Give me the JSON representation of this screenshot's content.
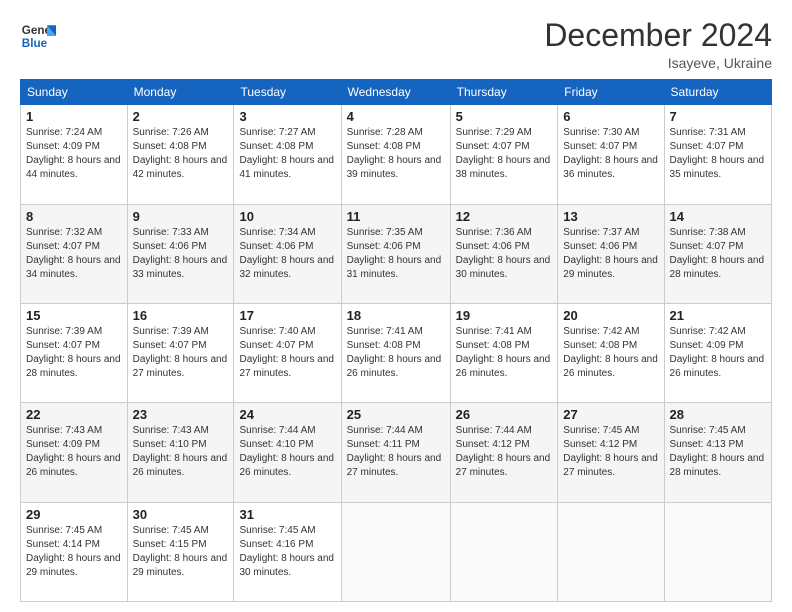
{
  "header": {
    "logo_line1": "General",
    "logo_line2": "Blue",
    "title": "December 2024",
    "subtitle": "Isayeve, Ukraine"
  },
  "days_of_week": [
    "Sunday",
    "Monday",
    "Tuesday",
    "Wednesday",
    "Thursday",
    "Friday",
    "Saturday"
  ],
  "weeks": [
    [
      {
        "num": "1",
        "sunrise": "7:24 AM",
        "sunset": "4:09 PM",
        "daylight": "8 hours and 44 minutes."
      },
      {
        "num": "2",
        "sunrise": "7:26 AM",
        "sunset": "4:08 PM",
        "daylight": "8 hours and 42 minutes."
      },
      {
        "num": "3",
        "sunrise": "7:27 AM",
        "sunset": "4:08 PM",
        "daylight": "8 hours and 41 minutes."
      },
      {
        "num": "4",
        "sunrise": "7:28 AM",
        "sunset": "4:08 PM",
        "daylight": "8 hours and 39 minutes."
      },
      {
        "num": "5",
        "sunrise": "7:29 AM",
        "sunset": "4:07 PM",
        "daylight": "8 hours and 38 minutes."
      },
      {
        "num": "6",
        "sunrise": "7:30 AM",
        "sunset": "4:07 PM",
        "daylight": "8 hours and 36 minutes."
      },
      {
        "num": "7",
        "sunrise": "7:31 AM",
        "sunset": "4:07 PM",
        "daylight": "8 hours and 35 minutes."
      }
    ],
    [
      {
        "num": "8",
        "sunrise": "7:32 AM",
        "sunset": "4:07 PM",
        "daylight": "8 hours and 34 minutes."
      },
      {
        "num": "9",
        "sunrise": "7:33 AM",
        "sunset": "4:06 PM",
        "daylight": "8 hours and 33 minutes."
      },
      {
        "num": "10",
        "sunrise": "7:34 AM",
        "sunset": "4:06 PM",
        "daylight": "8 hours and 32 minutes."
      },
      {
        "num": "11",
        "sunrise": "7:35 AM",
        "sunset": "4:06 PM",
        "daylight": "8 hours and 31 minutes."
      },
      {
        "num": "12",
        "sunrise": "7:36 AM",
        "sunset": "4:06 PM",
        "daylight": "8 hours and 30 minutes."
      },
      {
        "num": "13",
        "sunrise": "7:37 AM",
        "sunset": "4:06 PM",
        "daylight": "8 hours and 29 minutes."
      },
      {
        "num": "14",
        "sunrise": "7:38 AM",
        "sunset": "4:07 PM",
        "daylight": "8 hours and 28 minutes."
      }
    ],
    [
      {
        "num": "15",
        "sunrise": "7:39 AM",
        "sunset": "4:07 PM",
        "daylight": "8 hours and 28 minutes."
      },
      {
        "num": "16",
        "sunrise": "7:39 AM",
        "sunset": "4:07 PM",
        "daylight": "8 hours and 27 minutes."
      },
      {
        "num": "17",
        "sunrise": "7:40 AM",
        "sunset": "4:07 PM",
        "daylight": "8 hours and 27 minutes."
      },
      {
        "num": "18",
        "sunrise": "7:41 AM",
        "sunset": "4:08 PM",
        "daylight": "8 hours and 26 minutes."
      },
      {
        "num": "19",
        "sunrise": "7:41 AM",
        "sunset": "4:08 PM",
        "daylight": "8 hours and 26 minutes."
      },
      {
        "num": "20",
        "sunrise": "7:42 AM",
        "sunset": "4:08 PM",
        "daylight": "8 hours and 26 minutes."
      },
      {
        "num": "21",
        "sunrise": "7:42 AM",
        "sunset": "4:09 PM",
        "daylight": "8 hours and 26 minutes."
      }
    ],
    [
      {
        "num": "22",
        "sunrise": "7:43 AM",
        "sunset": "4:09 PM",
        "daylight": "8 hours and 26 minutes."
      },
      {
        "num": "23",
        "sunrise": "7:43 AM",
        "sunset": "4:10 PM",
        "daylight": "8 hours and 26 minutes."
      },
      {
        "num": "24",
        "sunrise": "7:44 AM",
        "sunset": "4:10 PM",
        "daylight": "8 hours and 26 minutes."
      },
      {
        "num": "25",
        "sunrise": "7:44 AM",
        "sunset": "4:11 PM",
        "daylight": "8 hours and 27 minutes."
      },
      {
        "num": "26",
        "sunrise": "7:44 AM",
        "sunset": "4:12 PM",
        "daylight": "8 hours and 27 minutes."
      },
      {
        "num": "27",
        "sunrise": "7:45 AM",
        "sunset": "4:12 PM",
        "daylight": "8 hours and 27 minutes."
      },
      {
        "num": "28",
        "sunrise": "7:45 AM",
        "sunset": "4:13 PM",
        "daylight": "8 hours and 28 minutes."
      }
    ],
    [
      {
        "num": "29",
        "sunrise": "7:45 AM",
        "sunset": "4:14 PM",
        "daylight": "8 hours and 29 minutes."
      },
      {
        "num": "30",
        "sunrise": "7:45 AM",
        "sunset": "4:15 PM",
        "daylight": "8 hours and 29 minutes."
      },
      {
        "num": "31",
        "sunrise": "7:45 AM",
        "sunset": "4:16 PM",
        "daylight": "8 hours and 30 minutes."
      },
      null,
      null,
      null,
      null
    ]
  ],
  "labels": {
    "sunrise": "Sunrise:",
    "sunset": "Sunset:",
    "daylight": "Daylight:"
  }
}
